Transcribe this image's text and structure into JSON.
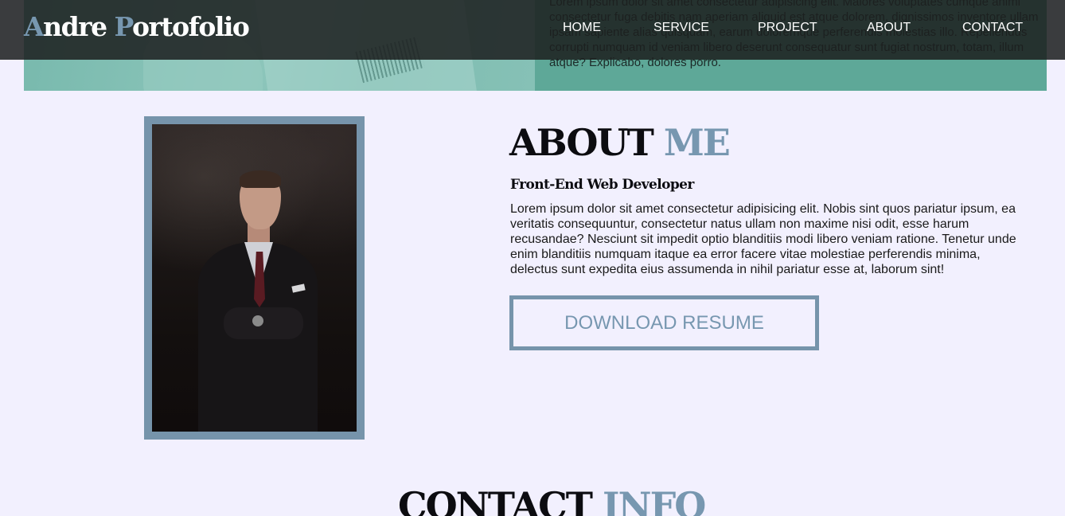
{
  "colors": {
    "accent": "#7797b0",
    "page_background": "#f2f0fe",
    "navbar_background": "#1c1e1e",
    "hero_band": "#5ea898",
    "text_dark": "#0c0c10",
    "nav_text": "#ffffff"
  },
  "brand": {
    "first_initial": "A",
    "first_rest": "ndre ",
    "second_initial": "P",
    "second_rest": "ortofolio"
  },
  "nav": {
    "items": [
      {
        "label": "HOME"
      },
      {
        "label": "SERVICE"
      },
      {
        "label": "PROJECT"
      },
      {
        "label": "ABOUT"
      },
      {
        "label": "CONTACT"
      }
    ]
  },
  "hero": {
    "text": "Lorem ipsum dolor sit amet consectetur adipisicing elit. Maiores voluptates cumque animi consectetur fuga debitis nam aperiam aliquid est atque dolorem, dignissimos inventore ullam ipsam sapiente alias quisquam, earum doloremque perferendis molestias illo. Repellendus corrupti numquam id veniam libero deserunt consequatur sunt fugiat nostrum, totam, illum atque? Explicabo, dolores porro.",
    "image_icon": "desk-paperwork-photo"
  },
  "about": {
    "title_main": "ABOUT ",
    "title_accent": "ME",
    "subtitle": "Front-End Web Developer",
    "body": "Lorem ipsum dolor sit amet consectetur adipisicing elit. Nobis sint quos pariatur ipsum, ea veritatis consequuntur, consectetur natus ullam non maxime nisi odit, esse harum recusandae? Nesciunt sit impedit optio blanditiis modi libero veniam ratione. Tenetur unde enim blanditiis numquam itaque ea error facere vitae molestiae perferendis minima, delectus sunt expedita eius assumenda in nihil pariatur esse at, laborum sint!",
    "button_label": "DOWNLOAD RESUME",
    "photo_icon": "businessman-portrait-photo"
  },
  "contact": {
    "title_main": "CONTACT ",
    "title_accent": "INFO"
  }
}
